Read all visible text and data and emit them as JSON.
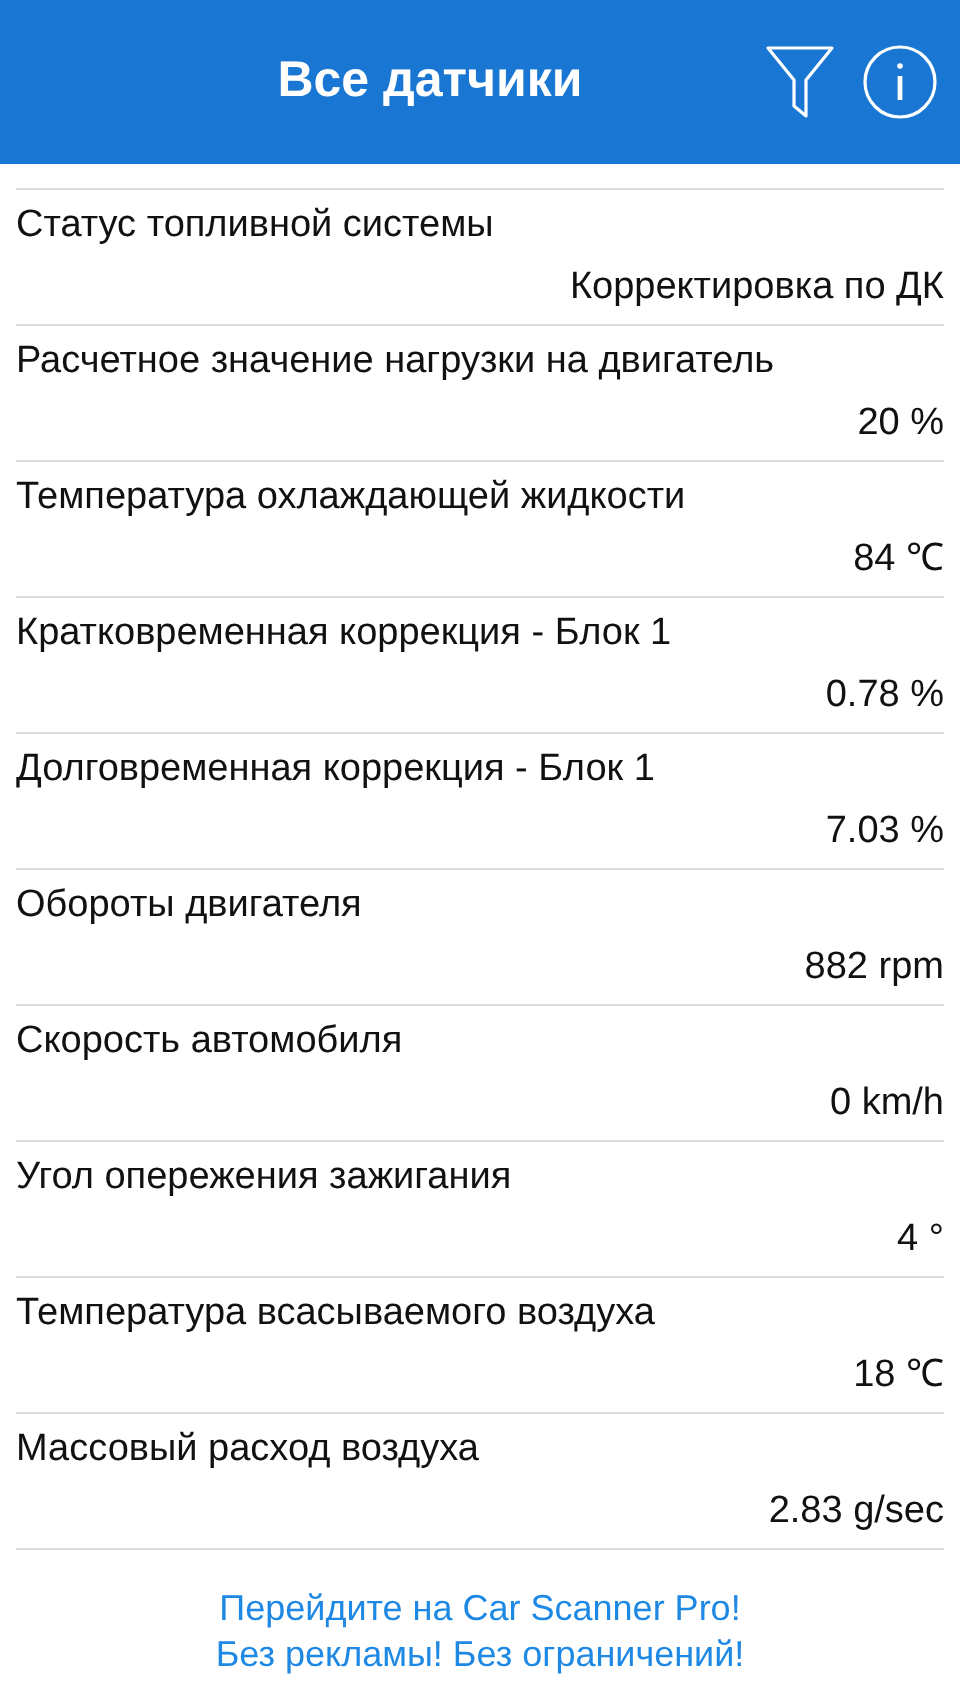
{
  "header": {
    "title": "Все датчики"
  },
  "sensors": [
    {
      "name": "Статус топливной системы",
      "value": "Корректировка по ДК"
    },
    {
      "name": "Расчетное значение нагрузки на двигатель",
      "value": "20 %"
    },
    {
      "name": "Температура охлаждающей жидкости",
      "value": "84 ℃"
    },
    {
      "name": "Кратковременная коррекция - Блок 1",
      "value": "0.78 %"
    },
    {
      "name": "Долговременная коррекция - Блок 1",
      "value": "7.03 %"
    },
    {
      "name": "Обороты двигателя",
      "value": "882 rpm"
    },
    {
      "name": "Скорость автомобиля",
      "value": "0 km/h"
    },
    {
      "name": "Угол опережения зажигания",
      "value": "4 °"
    },
    {
      "name": "Температура всасываемого воздуха",
      "value": "18 ℃"
    },
    {
      "name": "Массовый расход воздуха",
      "value": "2.83 g/sec"
    }
  ],
  "promo": [
    "Перейдите на Car Scanner Pro!",
    "Без рекламы! Без ограничений!"
  ]
}
